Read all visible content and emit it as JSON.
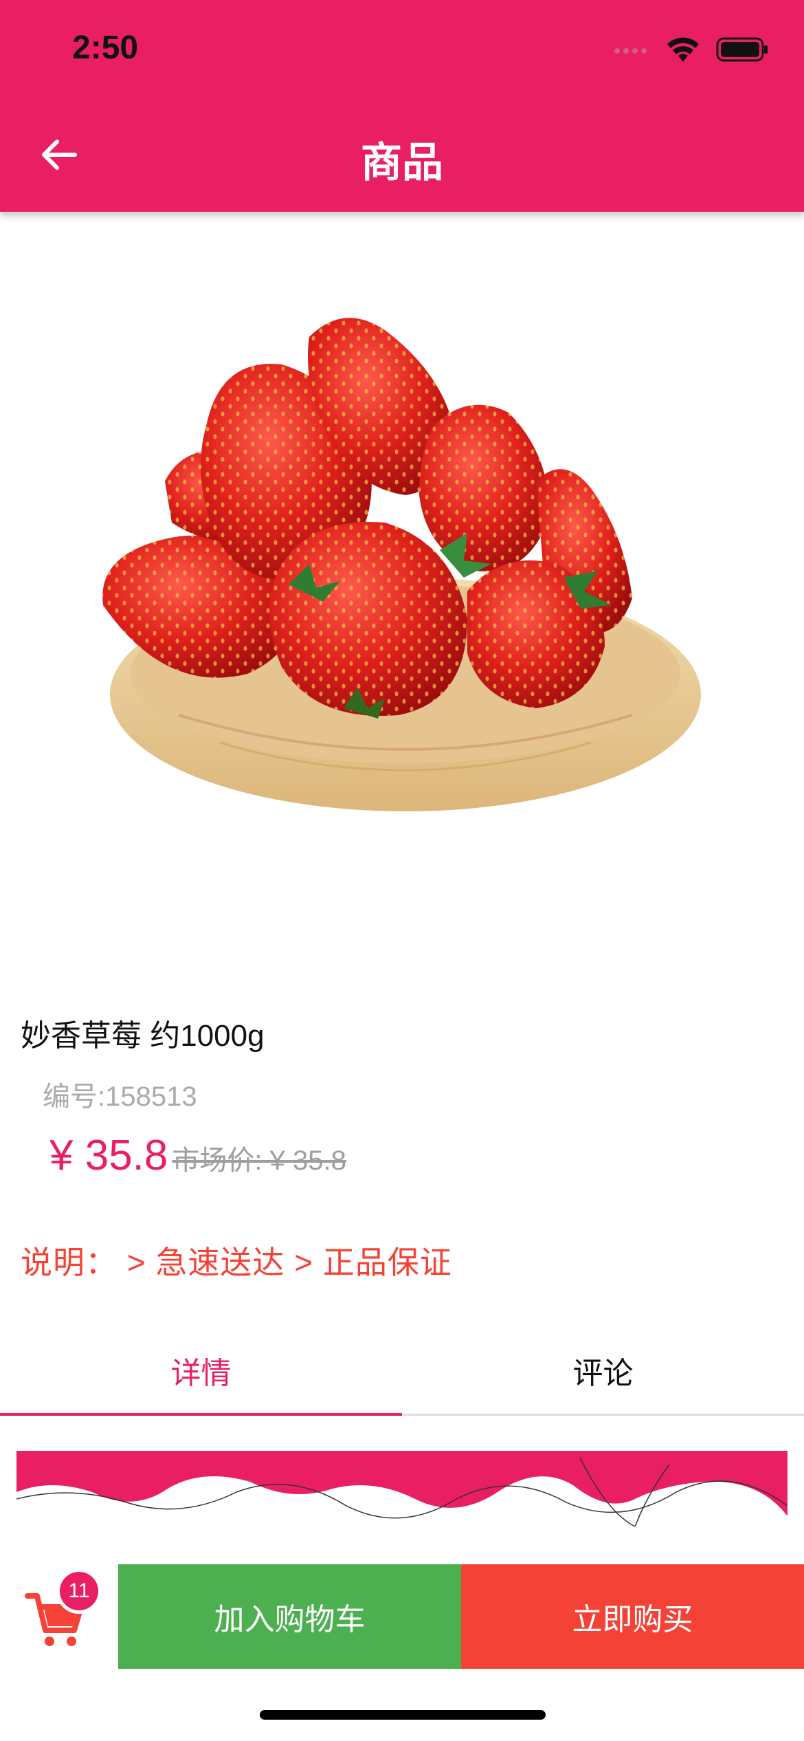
{
  "status_bar": {
    "time": "2:50"
  },
  "header": {
    "title": "商品"
  },
  "product": {
    "image_name": "strawberry-bowl",
    "name": "妙香草莓 约1000g",
    "sku": "编号:158513",
    "price": "¥ 35.8",
    "market_price": "市场价: ¥ 35.8",
    "description": "说明： > 急速送达 > 正品保证"
  },
  "tabs": [
    {
      "label": "详情",
      "active": true
    },
    {
      "label": "评论",
      "active": false
    }
  ],
  "cart": {
    "count": "11"
  },
  "actions": {
    "add_to_cart": "加入购物车",
    "buy_now": "立即购买"
  },
  "colors": {
    "primary": "#e91e63",
    "green": "#4caf50",
    "red": "#f44336"
  }
}
